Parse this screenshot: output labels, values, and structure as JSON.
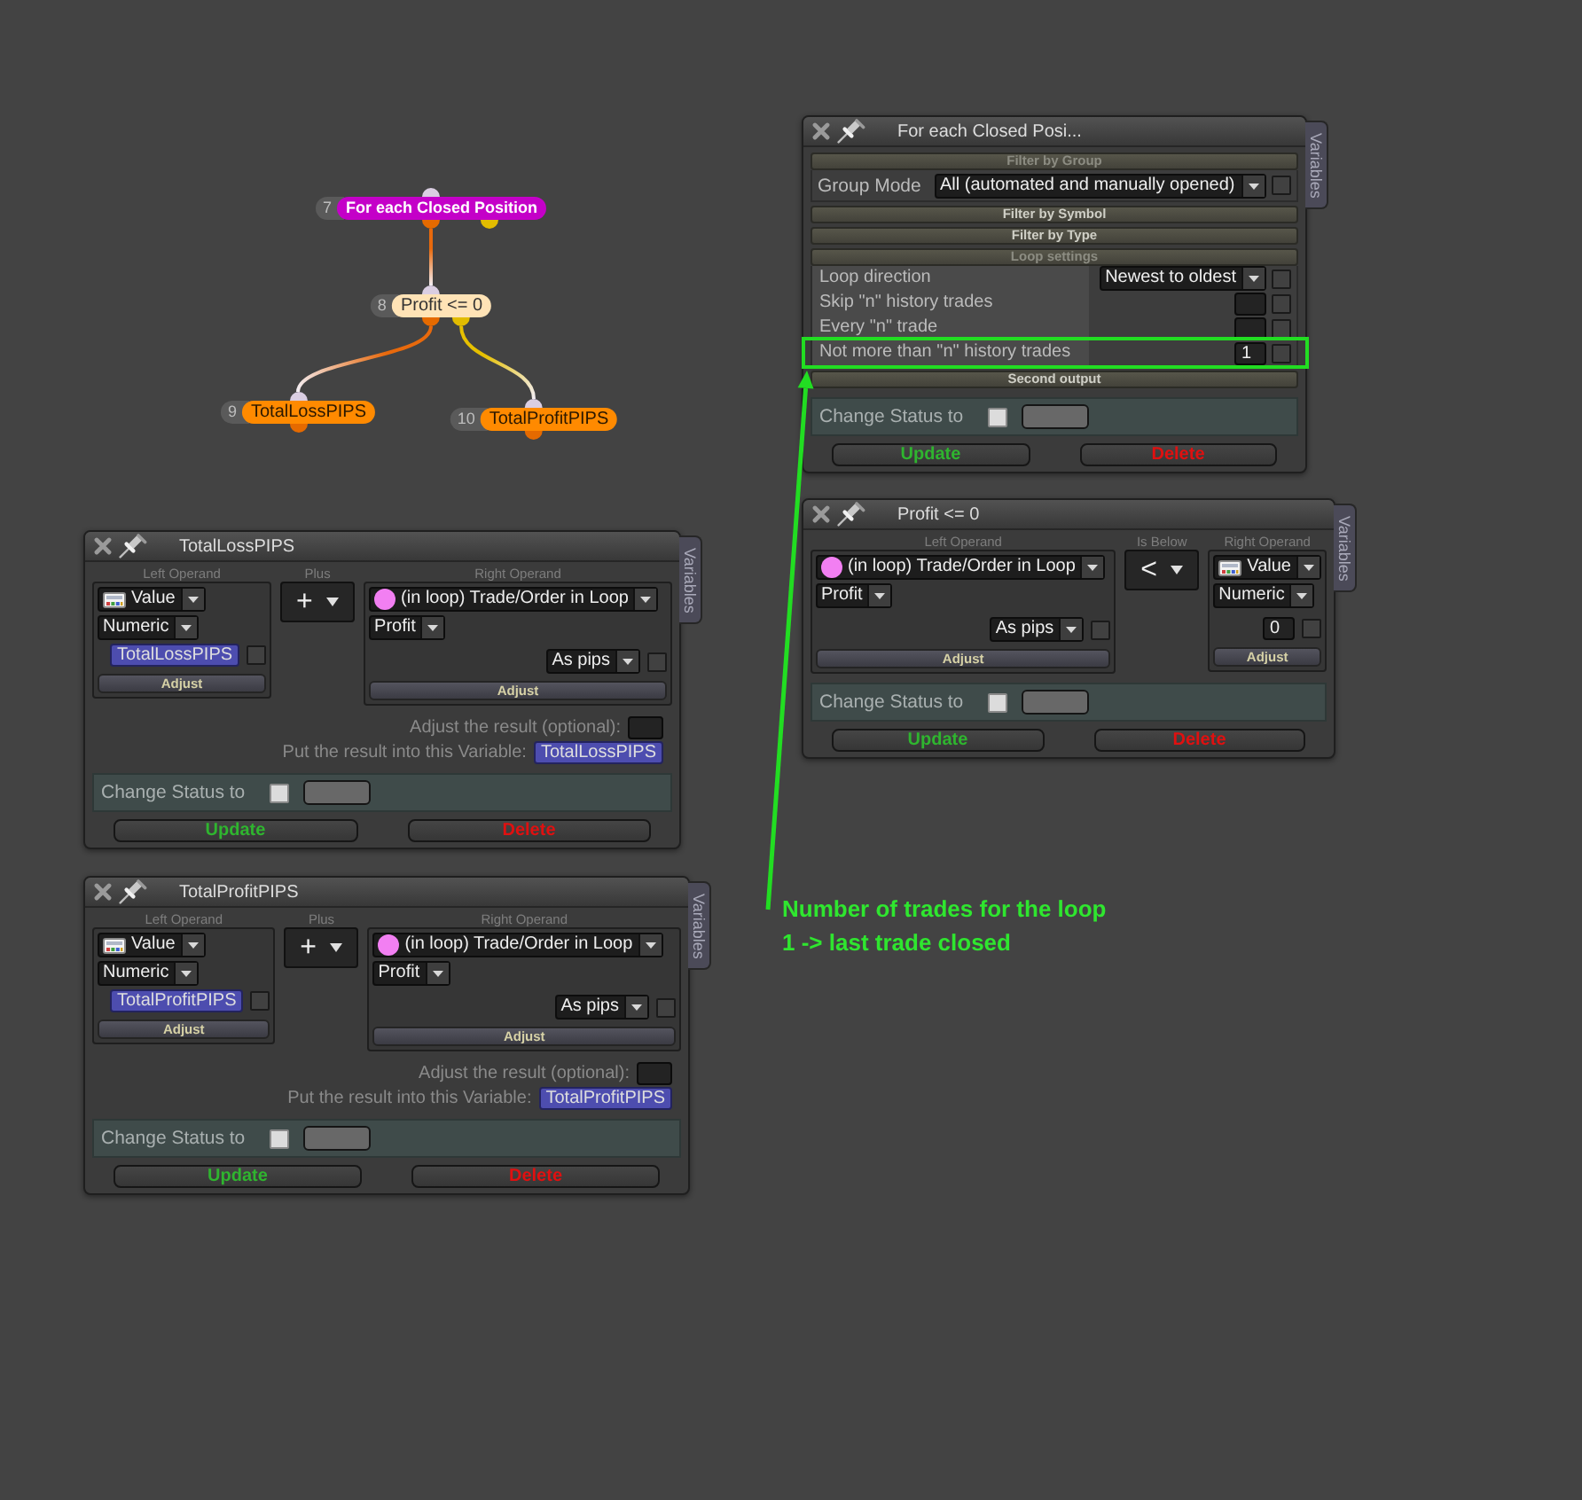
{
  "graph": {
    "nodes": [
      {
        "number": "7",
        "label": "For each Closed Position",
        "kind": "loop",
        "children": [
          {
            "number": "8",
            "label": "Profit <= 0",
            "kind": "condition",
            "children": [
              {
                "number": "9",
                "label": "TotalLossPIPS",
                "kind": "action"
              },
              {
                "number": "10",
                "label": "TotalProfitPIPS",
                "kind": "action"
              }
            ]
          }
        ]
      }
    ]
  },
  "panels": [
    {
      "kind": "loop",
      "title": "For each Closed Posi...",
      "variables_tab": "Variables",
      "sections": [
        {
          "title": "Filter by Group",
          "kind": "form",
          "expanded": true,
          "rows": [
            {
              "label": "Group Mode",
              "kind": "dropdown",
              "value": "All (automated and manually opened)",
              "checked": false,
              "highlighted": false
            }
          ]
        },
        {
          "title": "Filter by Symbol",
          "expanded": false
        },
        {
          "title": "Filter by Type",
          "expanded": false
        },
        {
          "title": "Loop settings",
          "kind": "table",
          "expanded": true,
          "rows": [
            {
              "label": "Loop direction",
              "kind": "dropdown",
              "value": "Newest to oldest",
              "checked": false,
              "highlighted": false
            },
            {
              "label": "Skip \"n\" history trades",
              "kind": "field",
              "checked": false,
              "highlighted": false
            },
            {
              "label": "Every \"n\" trade",
              "kind": "field",
              "checked": false,
              "highlighted": false
            },
            {
              "label": "Not more than \"n\" history trades",
              "kind": "field",
              "value": "1",
              "checked": false,
              "highlighted": true
            }
          ]
        },
        {
          "title": "Second output",
          "expanded": false
        }
      ],
      "status": {
        "label": "Change Status to",
        "checked": false
      },
      "buttons": [
        {
          "kind": "update",
          "label": "Update"
        },
        {
          "kind": "delete",
          "label": "Delete"
        }
      ]
    },
    {
      "kind": "condition",
      "title": "Profit <= 0",
      "variables_tab": "Variables",
      "left": {
        "header": "Left Operand",
        "controls": [
          {
            "kind": "loop-source",
            "label": "(in loop) Trade/Order in Loop"
          },
          {
            "kind": "select",
            "label": "Profit"
          },
          {
            "kind": "unit",
            "label": "As pips",
            "checked": false
          },
          {
            "kind": "adjust",
            "label": "Adjust"
          }
        ]
      },
      "operator": {
        "header": "Is Below",
        "symbol": "<"
      },
      "right": {
        "header": "Right Operand",
        "controls": [
          {
            "kind": "value-source",
            "label": "Value"
          },
          {
            "kind": "select",
            "label": "Numeric"
          },
          {
            "kind": "number",
            "value": "0",
            "checked": false
          },
          {
            "kind": "adjust",
            "label": "Adjust"
          }
        ]
      },
      "status": {
        "label": "Change Status to",
        "checked": false
      },
      "buttons": [
        {
          "kind": "update",
          "label": "Update"
        },
        {
          "kind": "delete",
          "label": "Delete"
        }
      ]
    },
    {
      "kind": "formula",
      "title": "TotalLossPIPS",
      "variables_tab": "Variables",
      "left": {
        "header": "Left Operand",
        "controls": [
          {
            "kind": "value-source",
            "label": "Value"
          },
          {
            "kind": "select",
            "label": "Numeric"
          },
          {
            "kind": "variable",
            "label": "TotalLossPIPS",
            "checked": false
          },
          {
            "kind": "adjust",
            "label": "Adjust"
          }
        ]
      },
      "operator": {
        "header": "Plus",
        "symbol": "+"
      },
      "right": {
        "header": "Right Operand",
        "controls": [
          {
            "kind": "loop-source",
            "label": "(in loop) Trade/Order in Loop"
          },
          {
            "kind": "select",
            "label": "Profit"
          },
          {
            "kind": "unit",
            "label": "As pips",
            "checked": false
          },
          {
            "kind": "adjust",
            "label": "Adjust"
          }
        ]
      },
      "result": {
        "adjust_label": "Adjust the result (optional):",
        "target_label": "Put the result into this Variable:",
        "target": "TotalLossPIPS"
      },
      "status": {
        "label": "Change Status to",
        "checked": false
      },
      "buttons": [
        {
          "kind": "update",
          "label": "Update"
        },
        {
          "kind": "delete",
          "label": "Delete"
        }
      ]
    },
    {
      "kind": "formula",
      "title": "TotalProfitPIPS",
      "variables_tab": "Variables",
      "left": {
        "header": "Left Operand",
        "controls": [
          {
            "kind": "value-source",
            "label": "Value"
          },
          {
            "kind": "select",
            "label": "Numeric"
          },
          {
            "kind": "variable",
            "label": "TotalProfitPIPS",
            "checked": false
          },
          {
            "kind": "adjust",
            "label": "Adjust"
          }
        ]
      },
      "operator": {
        "header": "Plus",
        "symbol": "+"
      },
      "right": {
        "header": "Right Operand",
        "controls": [
          {
            "kind": "loop-source",
            "label": "(in loop) Trade/Order in Loop"
          },
          {
            "kind": "select",
            "label": "Profit"
          },
          {
            "kind": "unit",
            "label": "As pips",
            "checked": false
          },
          {
            "kind": "adjust",
            "label": "Adjust"
          }
        ]
      },
      "result": {
        "adjust_label": "Adjust the result (optional):",
        "target_label": "Put the result into this Variable:",
        "target": "TotalProfitPIPS"
      },
      "status": {
        "label": "Change Status to",
        "checked": false
      },
      "buttons": [
        {
          "kind": "update",
          "label": "Update"
        },
        {
          "kind": "delete",
          "label": "Delete"
        }
      ]
    }
  ],
  "annotation": {
    "lines": [
      "Number of trades for the loop",
      "1 -> last trade closed"
    ]
  }
}
